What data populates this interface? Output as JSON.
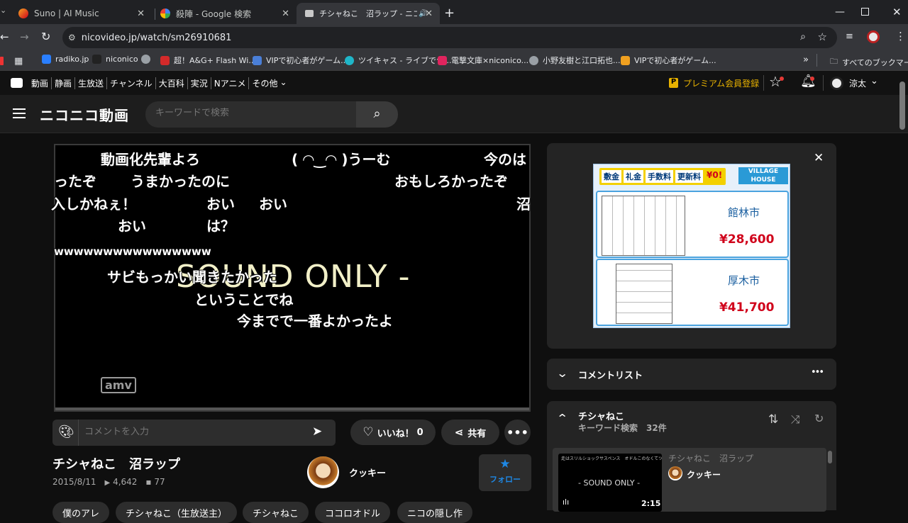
{
  "browser": {
    "tabs": [
      {
        "title": "Suno | AI Music"
      },
      {
        "title": "殺陣 - Google 検索"
      },
      {
        "title": "チシャねこ　沼ラップ - ニコニコ動"
      }
    ],
    "url": "nicovideo.jp/watch/sm26910681",
    "bookmarks": [
      "radiko.jp",
      "niconico",
      "",
      "超！A&G+ Flash Wi...",
      "VIPで初心者がゲーム...",
      "ツイキャス - ライブでつ...",
      "電撃文庫×niconico...",
      "小野友樹と江口拓也...",
      "VIPで初心者がゲーム..."
    ],
    "all_bookmarks": "すべてのブックマーク"
  },
  "nico_nav": {
    "items": [
      "動画",
      "静画",
      "生放送",
      "チャンネル",
      "大百科",
      "実況",
      "Nアニメ",
      "その他"
    ],
    "premium": "プレミアム会員登録",
    "username": "涼太"
  },
  "header": {
    "logo": "ニコニコ動画",
    "search_placeholder": "キーワードで検索"
  },
  "player": {
    "comments": [
      "動画化先輩よろ",
      "( ◠‿◠ )うーむ",
      "今のは",
      "ったぞ",
      "うまかったのに",
      "おもしろかったぞ",
      "入しかねぇ！",
      "おい",
      "おい",
      "沼",
      "おい",
      "は？",
      "wwwwwwwwwwwwwwww",
      "サビもっかい聞きたかった",
      "ということでね",
      "今までで一番よかったよ"
    ],
    "overlay": "SOUND ONLY -",
    "watermark": "amv"
  },
  "comment_input": {
    "placeholder": "コメントを入力"
  },
  "actions": {
    "like": "いいね！",
    "like_count": "0",
    "share": "共有"
  },
  "video": {
    "title": "チシャねこ　沼ラップ",
    "date": "2015/8/11",
    "views": "4,642",
    "comments": "77"
  },
  "uploader": {
    "name": "クッキー",
    "follow": "フォロー"
  },
  "tags": [
    "僕のアレ",
    "チシャねこ（生放送主）",
    "チシャねこ",
    "ココロオドル",
    "ニコの隠し作"
  ],
  "ad": {
    "banner_items": [
      "敷金",
      "礼金",
      "手数料",
      "更新料",
      "¥0!"
    ],
    "brand": "VILLAGE HOUSE",
    "cards": [
      {
        "city": "館林市",
        "price": "¥28,600"
      },
      {
        "city": "厚木市",
        "price": "¥41,700"
      }
    ]
  },
  "comment_list": {
    "label": "コメントリスト"
  },
  "playlist": {
    "title": "チシャねこ",
    "subtitle": "キーワード検索",
    "count": "32件",
    "item": {
      "title": "チシャねこ　沼ラップ",
      "uploader": "クッキー",
      "duration": "2:15",
      "thumb_text": "- SOUND ONLY -",
      "thumb_top_text": "走はスリルショックサスペンス　オドルこのなくてツバサが"
    }
  },
  "colors": {
    "accent": "#1e88e5",
    "price": "#d0021b",
    "premium": "#e8b200"
  }
}
